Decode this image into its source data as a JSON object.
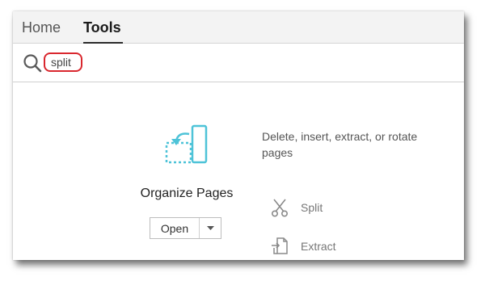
{
  "tabs": [
    {
      "label": "Home",
      "active": false
    },
    {
      "label": "Tools",
      "active": true
    }
  ],
  "search": {
    "icon": "search-icon",
    "value": "split",
    "highlight_color": "#d9272e"
  },
  "tool": {
    "icon": "organize-pages-icon",
    "icon_color": "#4ec3d8",
    "title": "Organize Pages",
    "open_label": "Open",
    "dropdown_icon": "chevron-down-icon",
    "description": "Delete, insert, extract, or rotate pages",
    "sub_tools": [
      {
        "label": "Split",
        "icon": "scissors-icon"
      },
      {
        "label": "Extract",
        "icon": "extract-icon"
      }
    ]
  }
}
